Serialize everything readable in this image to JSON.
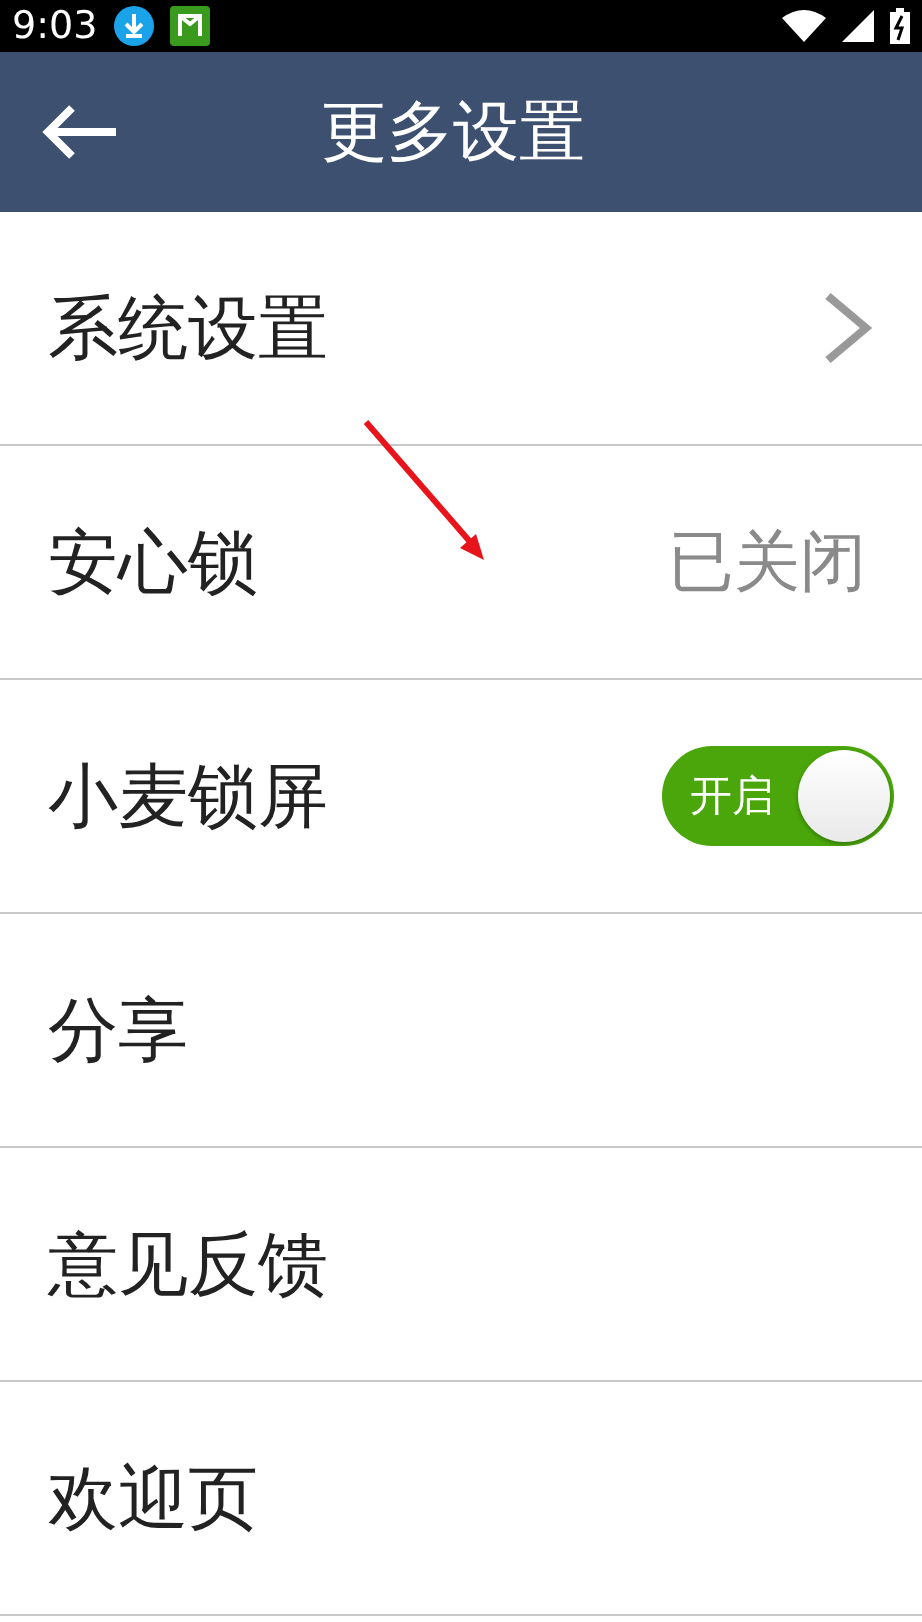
{
  "status_bar": {
    "time": "9:03"
  },
  "header": {
    "title": "更多设置"
  },
  "rows": [
    {
      "kind": "chevron",
      "label": "系统设置"
    },
    {
      "kind": "value",
      "label": "安心锁",
      "value": "已关闭"
    },
    {
      "kind": "toggle",
      "label": "小麦锁屏",
      "on": true,
      "toggle_label": "开启"
    },
    {
      "kind": "plain",
      "label": "分享"
    },
    {
      "kind": "plain",
      "label": "意见反馈"
    },
    {
      "kind": "plain",
      "label": "欢迎页"
    }
  ]
}
